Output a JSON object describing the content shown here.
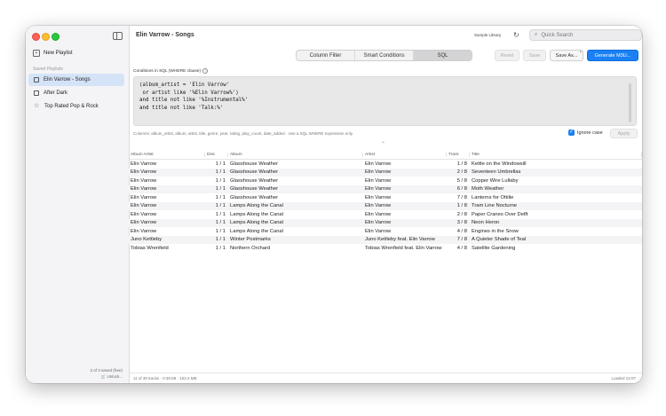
{
  "window": {
    "title": "Elin Varrow - Songs"
  },
  "sidebar": {
    "new_playlist": "New Playlist",
    "section_title": "Saved Playlists",
    "items": [
      {
        "label": "Elin Varrow - Songs",
        "icon": "playlist-icon"
      },
      {
        "label": "After Dark",
        "icon": "grid-icon"
      },
      {
        "label": "Top Rated Pop & Rock",
        "icon": "star-icon"
      }
    ],
    "footer_count": "3 of 3 saved (free)",
    "footer_unlock": "Unlock..."
  },
  "toolbar": {
    "library_label": "Sample Library",
    "search_placeholder": "Quick Search",
    "tabs": [
      "Column Filter",
      "Smart Conditions",
      "SQL"
    ],
    "active_tab": "SQL",
    "reset": "Reset",
    "save": "Save",
    "save_as": "Save As...",
    "generate": "Generate M3U..."
  },
  "editor": {
    "label": "Conditions in SQL (WHERE clause)",
    "code": "(album_artist = 'Elin Varrow'\n or artist like '%Elin Varrow%')\nand title not like '%Instrumental%'\nand title not like 'Talk:%'",
    "helper": "Columns: album_artist, album, artist, title, genre, year, rating, play_count, date_added · Use a SQL WHERE expression only.",
    "ignore_case": "Ignore case",
    "ignore_case_checked": true,
    "apply": "Apply"
  },
  "table": {
    "columns": [
      "Album Artist",
      "Disc",
      "Album",
      "Artist",
      "Track",
      "Title"
    ],
    "rows": [
      [
        "Elin Varrow",
        "1 / 1",
        "Glasshouse Weather",
        "Elin Varrow",
        "1 / 8",
        "Kettle on the Windowsill"
      ],
      [
        "Elin Varrow",
        "1 / 1",
        "Glasshouse Weather",
        "Elin Varrow",
        "2 / 8",
        "Seventeen Umbrellas"
      ],
      [
        "Elin Varrow",
        "1 / 1",
        "Glasshouse Weather",
        "Elin Varrow",
        "5 / 8",
        "Copper Wire Lullaby"
      ],
      [
        "Elin Varrow",
        "1 / 1",
        "Glasshouse Weather",
        "Elin Varrow",
        "6 / 8",
        "Moth Weather"
      ],
      [
        "Elin Varrow",
        "1 / 1",
        "Glasshouse Weather",
        "Elin Varrow",
        "7 / 8",
        "Lanterns for Ottilie"
      ],
      [
        "Elin Varrow",
        "1 / 1",
        "Lamps Along the Canal",
        "Elin Varrow",
        "1 / 8",
        "Tram Line Nocturne"
      ],
      [
        "Elin Varrow",
        "1 / 1",
        "Lamps Along the Canal",
        "Elin Varrow",
        "2 / 8",
        "Paper Cranes Over Delft"
      ],
      [
        "Elin Varrow",
        "1 / 1",
        "Lamps Along the Canal",
        "Elin Varrow",
        "3 / 8",
        "Neon Heron"
      ],
      [
        "Elin Varrow",
        "1 / 1",
        "Lamps Along the Canal",
        "Elin Varrow",
        "4 / 8",
        "Engines in the Snow"
      ],
      [
        "Juno Kettleby",
        "1 / 1",
        "Winter Postmarks",
        "Juno Kettleby feat. Elin Varrow",
        "7 / 8",
        "A Quieter Shade of Teal"
      ],
      [
        "Tobias Wrenfield",
        "1 / 1",
        "Northern Orchard",
        "Tobias Wrenfield feat. Elin Varrow",
        "4 / 8",
        "Satellite Gardening"
      ]
    ]
  },
  "status": {
    "left": "11 of 30 tracks · 0:39:58 · 103.4 MB",
    "right": "Loaded 12:07"
  },
  "colors": {
    "accent": "#1a80f4",
    "selection": "#d4e3f7"
  }
}
